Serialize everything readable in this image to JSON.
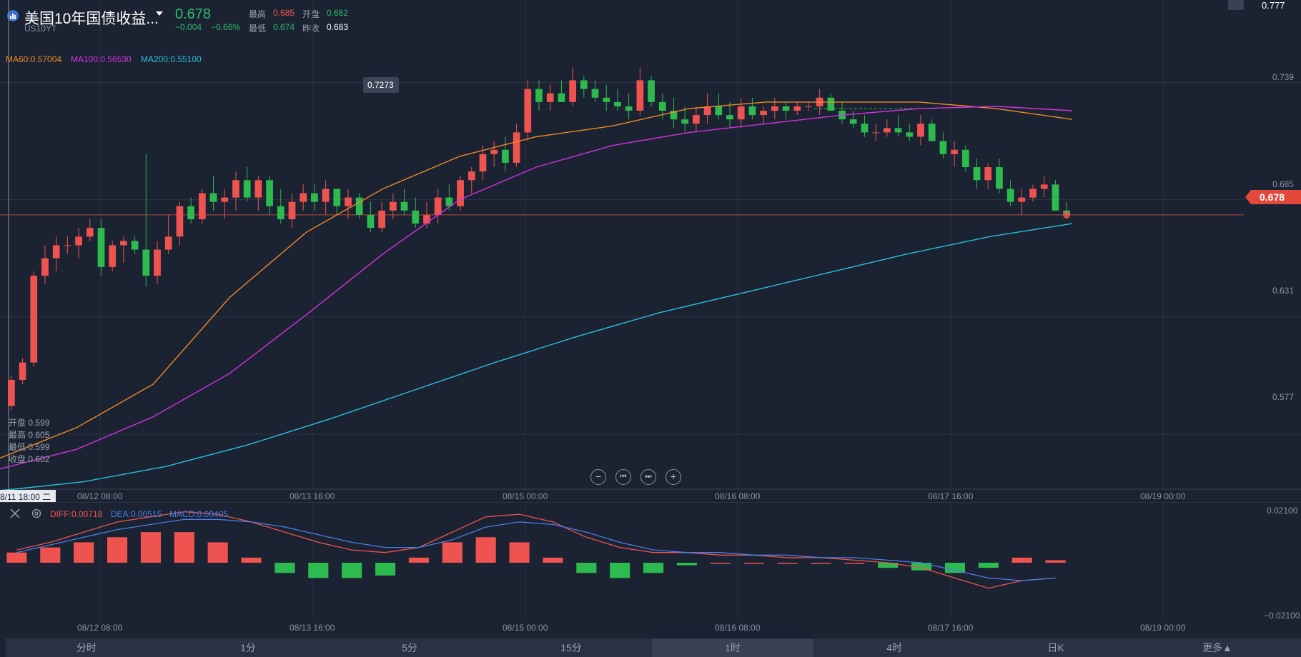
{
  "header": {
    "title": "美国10年国债收益...",
    "symbol": "US10YT",
    "price": "0.678",
    "change": "−0.004",
    "change_pct": "−0.66%",
    "high_label": "最高",
    "high_value": "0.685",
    "open_label": "开盘",
    "open_value": "0.682",
    "low_label": "最低",
    "low_value": "0.674",
    "prev_close_label": "昨收",
    "prev_close_value": "0.683",
    "top_right_value": "0.777"
  },
  "ma_legend": {
    "ma60": "MA60:0.57004",
    "ma100": "MA100:0.56530",
    "ma200": "MA200:0.55100"
  },
  "ohlc_tooltip": {
    "open": "开盘 0.599",
    "high": "最高 0.605",
    "low": "最低 0.599",
    "close": "收盘 0.602"
  },
  "price_axis": [
    "0.739",
    "0.685",
    "0.631",
    "0.577"
  ],
  "current_price_tag": "0.678",
  "peak_label": "0.7273",
  "time_axis": [
    "08/12 08:00",
    "08/13 16:00",
    "08/15 00:00",
    "08/16 08:00",
    "08/17 16:00",
    "08/19 00:00"
  ],
  "crosshair_time": "8/11 18:00 二",
  "macd_legend": {
    "diff": "DIFF:0.00718",
    "dea": "DEA:0.00515",
    "macd": "MACD:0.00405"
  },
  "macd_axis": {
    "top": "0.02100",
    "bottom": "−0.02100"
  },
  "tabs": [
    "分时",
    "1分",
    "5分",
    "15分",
    "1时",
    "4时",
    "日K",
    "更多▲"
  ],
  "active_tab": "1时",
  "colors": {
    "background": "#1b2232",
    "up": "#ef5350",
    "down": "#2dba4e",
    "ma60": "#f08a24",
    "ma100": "#d332e0",
    "ma200": "#27c3d6",
    "diff": "#ef5350",
    "dea": "#4a7fe8"
  },
  "chart_data": {
    "type": "candlestick",
    "title": "美国10年国债收益...",
    "interval": "1时",
    "ylim": [
      0.55,
      0.777
    ],
    "candles": [
      [
        0.59,
        0.604,
        0.588,
        0.602
      ],
      [
        0.602,
        0.612,
        0.6,
        0.61
      ],
      [
        0.61,
        0.652,
        0.608,
        0.65
      ],
      [
        0.65,
        0.664,
        0.646,
        0.658
      ],
      [
        0.658,
        0.668,
        0.652,
        0.664
      ],
      [
        0.664,
        0.668,
        0.66,
        0.664
      ],
      [
        0.664,
        0.672,
        0.658,
        0.668
      ],
      [
        0.668,
        0.676,
        0.666,
        0.672
      ],
      [
        0.672,
        0.676,
        0.65,
        0.654
      ],
      [
        0.654,
        0.666,
        0.652,
        0.664
      ],
      [
        0.664,
        0.668,
        0.656,
        0.666
      ],
      [
        0.666,
        0.668,
        0.66,
        0.662
      ],
      [
        0.662,
        0.706,
        0.645,
        0.65
      ],
      [
        0.65,
        0.666,
        0.646,
        0.662
      ],
      [
        0.662,
        0.678,
        0.66,
        0.668
      ],
      [
        0.668,
        0.684,
        0.664,
        0.682
      ],
      [
        0.682,
        0.686,
        0.674,
        0.676
      ],
      [
        0.676,
        0.69,
        0.674,
        0.688
      ],
      [
        0.688,
        0.696,
        0.68,
        0.684
      ],
      [
        0.684,
        0.69,
        0.676,
        0.686
      ],
      [
        0.686,
        0.698,
        0.68,
        0.694
      ],
      [
        0.694,
        0.7,
        0.684,
        0.686
      ],
      [
        0.686,
        0.696,
        0.68,
        0.694
      ],
      [
        0.694,
        0.696,
        0.678,
        0.682
      ],
      [
        0.682,
        0.69,
        0.674,
        0.676
      ],
      [
        0.676,
        0.688,
        0.672,
        0.684
      ],
      [
        0.684,
        0.692,
        0.68,
        0.688
      ],
      [
        0.688,
        0.692,
        0.68,
        0.684
      ],
      [
        0.684,
        0.694,
        0.678,
        0.69
      ],
      [
        0.69,
        0.69,
        0.678,
        0.682
      ],
      [
        0.682,
        0.69,
        0.676,
        0.686
      ],
      [
        0.686,
        0.688,
        0.676,
        0.678
      ],
      [
        0.678,
        0.684,
        0.67,
        0.672
      ],
      [
        0.672,
        0.684,
        0.67,
        0.68
      ],
      [
        0.68,
        0.688,
        0.676,
        0.684
      ],
      [
        0.684,
        0.69,
        0.678,
        0.68
      ],
      [
        0.68,
        0.686,
        0.672,
        0.674
      ],
      [
        0.674,
        0.684,
        0.672,
        0.678
      ],
      [
        0.678,
        0.69,
        0.674,
        0.686
      ],
      [
        0.686,
        0.692,
        0.68,
        0.682
      ],
      [
        0.682,
        0.696,
        0.68,
        0.694
      ],
      [
        0.694,
        0.7,
        0.688,
        0.698
      ],
      [
        0.698,
        0.71,
        0.694,
        0.706
      ],
      [
        0.706,
        0.712,
        0.7,
        0.708
      ],
      [
        0.708,
        0.714,
        0.698,
        0.702
      ],
      [
        0.702,
        0.72,
        0.7,
        0.716
      ],
      [
        0.716,
        0.74,
        0.712,
        0.736
      ],
      [
        0.736,
        0.74,
        0.726,
        0.73
      ],
      [
        0.73,
        0.738,
        0.726,
        0.734
      ],
      [
        0.734,
        0.74,
        0.73,
        0.73
      ],
      [
        0.73,
        0.746,
        0.728,
        0.74
      ],
      [
        0.74,
        0.742,
        0.732,
        0.736
      ],
      [
        0.736,
        0.74,
        0.73,
        0.732
      ],
      [
        0.732,
        0.738,
        0.726,
        0.73
      ],
      [
        0.73,
        0.736,
        0.726,
        0.728
      ],
      [
        0.728,
        0.734,
        0.722,
        0.726
      ],
      [
        0.726,
        0.746,
        0.724,
        0.74
      ],
      [
        0.74,
        0.742,
        0.728,
        0.73
      ],
      [
        0.73,
        0.734,
        0.722,
        0.726
      ],
      [
        0.726,
        0.732,
        0.718,
        0.722
      ],
      [
        0.722,
        0.728,
        0.716,
        0.72
      ],
      [
        0.72,
        0.728,
        0.716,
        0.724
      ],
      [
        0.724,
        0.734,
        0.72,
        0.728
      ],
      [
        0.728,
        0.734,
        0.722,
        0.724
      ],
      [
        0.724,
        0.73,
        0.718,
        0.722
      ],
      [
        0.722,
        0.732,
        0.718,
        0.728
      ],
      [
        0.728,
        0.732,
        0.722,
        0.724
      ],
      [
        0.724,
        0.728,
        0.72,
        0.726
      ],
      [
        0.726,
        0.732,
        0.722,
        0.728
      ],
      [
        0.728,
        0.73,
        0.722,
        0.726
      ],
      [
        0.726,
        0.73,
        0.724,
        0.728
      ],
      [
        0.728,
        0.73,
        0.726,
        0.728
      ],
      [
        0.728,
        0.736,
        0.724,
        0.732
      ],
      [
        0.732,
        0.734,
        0.726,
        0.726
      ],
      [
        0.726,
        0.73,
        0.72,
        0.722
      ],
      [
        0.722,
        0.726,
        0.718,
        0.72
      ],
      [
        0.72,
        0.724,
        0.714,
        0.716
      ],
      [
        0.716,
        0.72,
        0.712,
        0.716
      ],
      [
        0.716,
        0.722,
        0.714,
        0.718
      ],
      [
        0.718,
        0.724,
        0.714,
        0.716
      ],
      [
        0.716,
        0.72,
        0.712,
        0.714
      ],
      [
        0.714,
        0.724,
        0.71,
        0.72
      ],
      [
        0.72,
        0.722,
        0.712,
        0.712
      ],
      [
        0.712,
        0.716,
        0.704,
        0.706
      ],
      [
        0.706,
        0.712,
        0.7,
        0.708
      ],
      [
        0.708,
        0.71,
        0.698,
        0.7
      ],
      [
        0.7,
        0.704,
        0.69,
        0.694
      ],
      [
        0.694,
        0.702,
        0.69,
        0.7
      ],
      [
        0.7,
        0.704,
        0.688,
        0.69
      ],
      [
        0.69,
        0.694,
        0.682,
        0.684
      ],
      [
        0.684,
        0.69,
        0.678,
        0.686
      ],
      [
        0.686,
        0.692,
        0.684,
        0.69
      ],
      [
        0.69,
        0.696,
        0.686,
        0.692
      ],
      [
        0.692,
        0.694,
        0.68,
        0.68
      ],
      [
        0.68,
        0.684,
        0.676,
        0.678
      ]
    ],
    "ma60_values": [
      0.566,
      0.58,
      0.6,
      0.64,
      0.67,
      0.69,
      0.705,
      0.714,
      0.719,
      0.727,
      0.73,
      0.73,
      0.73,
      0.727,
      0.722
    ],
    "ma100_values": [
      0.561,
      0.57,
      0.585,
      0.605,
      0.632,
      0.66,
      0.685,
      0.7,
      0.71,
      0.716,
      0.72,
      0.724,
      0.727,
      0.728,
      0.726
    ],
    "ma200_values": [
      0.551,
      0.555,
      0.562,
      0.572,
      0.584,
      0.597,
      0.61,
      0.622,
      0.633,
      0.642,
      0.651,
      0.66,
      0.668,
      0.674
    ],
    "macd_panel": {
      "ylim": [
        -0.021,
        0.021
      ],
      "diff": [
        0.005,
        0.008,
        0.012,
        0.016,
        0.018,
        0.02,
        0.019,
        0.016,
        0.012,
        0.008,
        0.005,
        0.004,
        0.006,
        0.012,
        0.018,
        0.019,
        0.016,
        0.01,
        0.006,
        0.004,
        0.004,
        0.003,
        0.003,
        0.002,
        0.002,
        0.001,
        0.0,
        -0.002,
        -0.006,
        -0.01,
        -0.007,
        -0.006
      ],
      "dea": [
        0.004,
        0.007,
        0.01,
        0.013,
        0.015,
        0.017,
        0.017,
        0.016,
        0.014,
        0.011,
        0.008,
        0.006,
        0.006,
        0.009,
        0.014,
        0.016,
        0.015,
        0.012,
        0.008,
        0.005,
        0.004,
        0.004,
        0.003,
        0.003,
        0.002,
        0.002,
        0.001,
        0.0,
        -0.003,
        -0.006,
        -0.007,
        -0.006
      ],
      "macd": [
        0.004,
        0.006,
        0.008,
        0.01,
        0.012,
        0.012,
        0.008,
        0.002,
        -0.004,
        -0.006,
        -0.006,
        -0.005,
        0.002,
        0.008,
        0.01,
        0.008,
        0.002,
        -0.004,
        -0.006,
        -0.004,
        -0.001,
        0.0,
        0.0,
        0.0,
        0.0,
        0.0,
        -0.002,
        -0.003,
        -0.004,
        -0.002,
        0.002,
        0.001
      ]
    }
  }
}
